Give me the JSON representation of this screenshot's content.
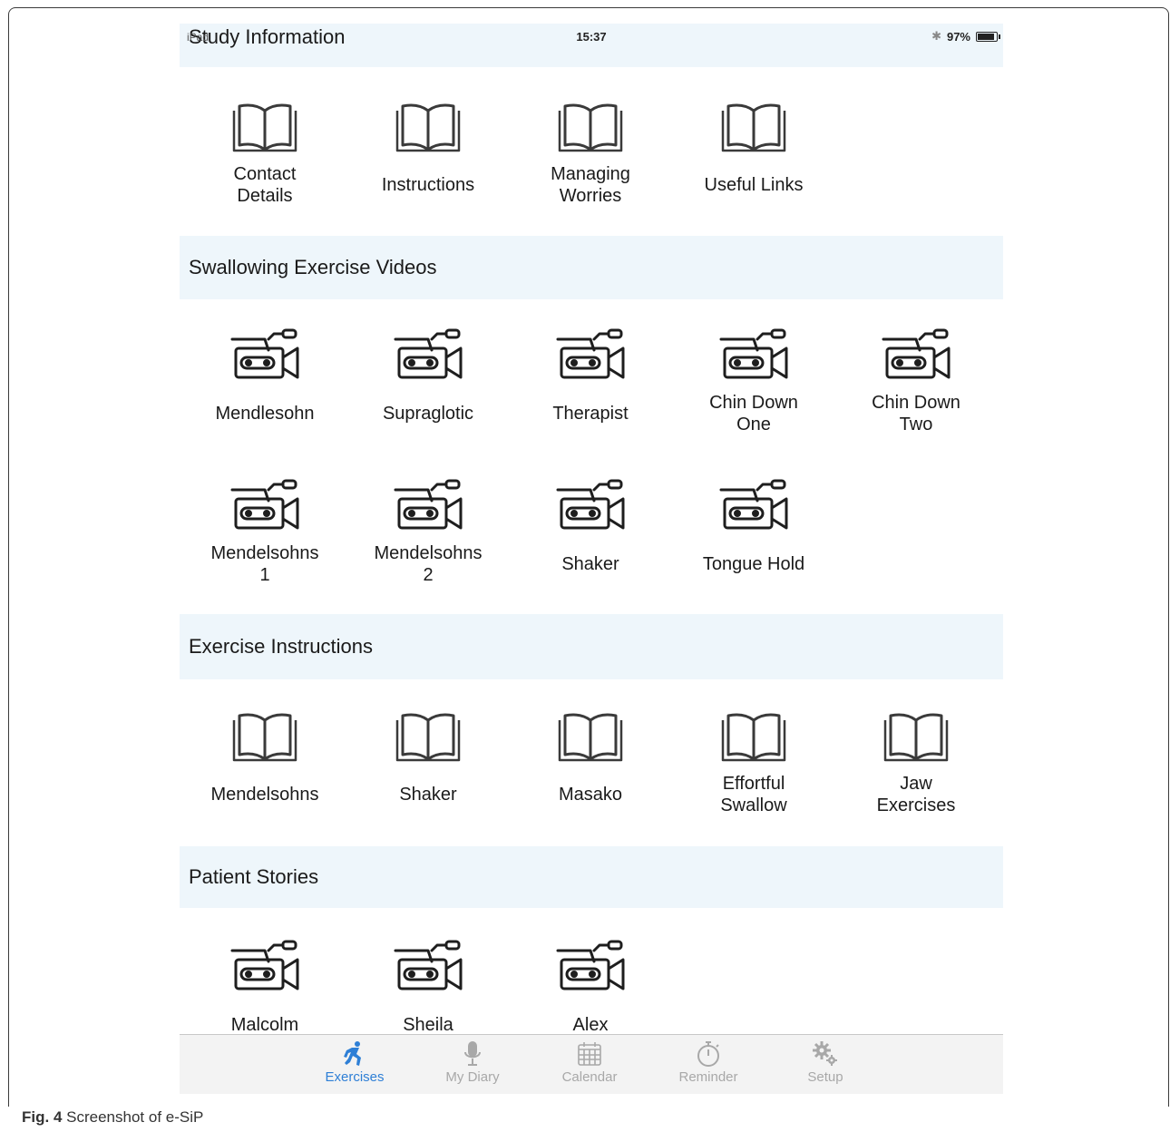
{
  "status_bar": {
    "carrier": "iPad",
    "time": "15:37",
    "battery": "97%",
    "battery_level": 0.97
  },
  "sections": [
    {
      "title": "Study Information",
      "rows": [
        [
          {
            "icon": "book-icon",
            "label": [
              "Contact",
              "Details"
            ]
          },
          {
            "icon": "book-icon",
            "label": [
              "Instructions"
            ]
          },
          {
            "icon": "book-icon",
            "label": [
              "Managing",
              "Worries"
            ]
          },
          {
            "icon": "book-icon",
            "label": [
              "Useful Links"
            ]
          }
        ]
      ]
    },
    {
      "title": "Swallowing Exercise Videos",
      "rows": [
        [
          {
            "icon": "video-camera-icon",
            "label": [
              "Mendlesohn"
            ]
          },
          {
            "icon": "video-camera-icon",
            "label": [
              "Supraglotic"
            ]
          },
          {
            "icon": "video-camera-icon",
            "label": [
              "Therapist"
            ]
          },
          {
            "icon": "video-camera-icon",
            "label": [
              "Chin Down",
              "One"
            ]
          },
          {
            "icon": "video-camera-icon",
            "label": [
              "Chin Down",
              "Two"
            ]
          }
        ],
        [
          {
            "icon": "video-camera-icon",
            "label": [
              "Mendelsohns",
              "1"
            ]
          },
          {
            "icon": "video-camera-icon",
            "label": [
              "Mendelsohns",
              "2"
            ]
          },
          {
            "icon": "video-camera-icon",
            "label": [
              "Shaker"
            ]
          },
          {
            "icon": "video-camera-icon",
            "label": [
              "Tongue Hold"
            ]
          }
        ]
      ]
    },
    {
      "title": "Exercise Instructions",
      "rows": [
        [
          {
            "icon": "book-icon",
            "label": [
              "Mendelsohns"
            ]
          },
          {
            "icon": "book-icon",
            "label": [
              "Shaker"
            ]
          },
          {
            "icon": "book-icon",
            "label": [
              "Masako"
            ]
          },
          {
            "icon": "book-icon",
            "label": [
              "Effortful",
              "Swallow"
            ]
          },
          {
            "icon": "book-icon",
            "label": [
              "Jaw",
              "Exercises"
            ]
          }
        ]
      ]
    },
    {
      "title": "Patient Stories",
      "rows": [
        [
          {
            "icon": "video-camera-icon",
            "label": [
              "Malcolm"
            ]
          },
          {
            "icon": "video-camera-icon",
            "label": [
              "Sheila"
            ]
          },
          {
            "icon": "video-camera-icon",
            "label": [
              "Alex"
            ]
          }
        ]
      ]
    }
  ],
  "tab_bar": [
    {
      "icon": "running-person-icon",
      "label": "Exercises",
      "active": true
    },
    {
      "icon": "microphone-icon",
      "label": "My Diary",
      "active": false
    },
    {
      "icon": "calendar-icon",
      "label": "Calendar",
      "active": false
    },
    {
      "icon": "stopwatch-icon",
      "label": "Reminder",
      "active": false
    },
    {
      "icon": "gear-icon",
      "label": "Setup",
      "active": false
    }
  ],
  "colors": {
    "accent": "#2e7fd6",
    "header_bg": "#eef6fb",
    "tab_inactive": "#a8a8a8",
    "icon_stroke": "#3a3a3a"
  },
  "caption": {
    "fig": "Fig. 4",
    "text": "Screenshot of e-SiP"
  }
}
